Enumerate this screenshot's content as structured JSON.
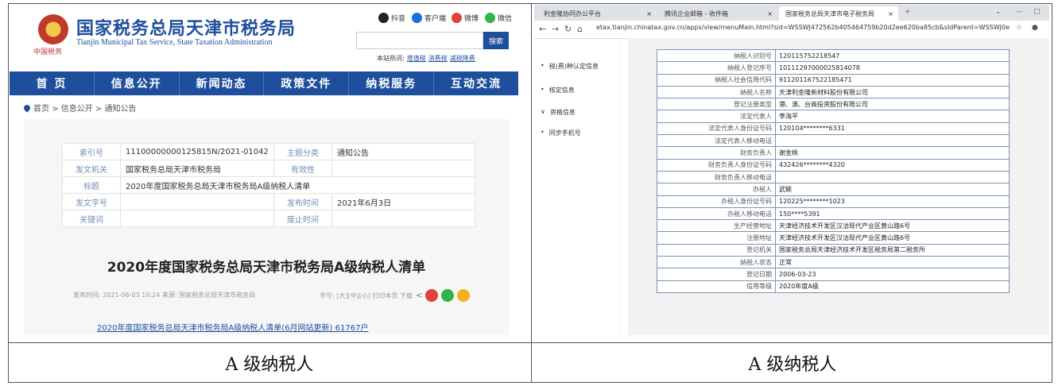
{
  "left": {
    "emblem_text": "中国税务",
    "site_title": "国家税务总局天津市税务局",
    "site_subtitle": "Tianjin Municipal Tax Service, State Taxation Administration",
    "social": [
      "抖音",
      "客户端",
      "微博",
      "微信"
    ],
    "search_button": "搜索",
    "hot_label": "本站热词:",
    "hot_words": [
      "增值税",
      "消费税",
      "减税降费"
    ],
    "nav": [
      "首 页",
      "信息公开",
      "新闻动态",
      "政策文件",
      "纳税服务",
      "互动交流"
    ],
    "breadcrumb": "首页 > 信息公开 > 通知公告",
    "info": {
      "index_label": "索引号",
      "index_value": "11100000000125815N/2021-01042",
      "topic_label": "主题分类",
      "topic_value": "通知公告",
      "org_label": "发文机关",
      "org_value": "国家税务总局天津市税务局",
      "validity_label": "有效性",
      "validity_value": "",
      "title_label": "标题",
      "title_value": "2020年度国家税务总局天津市税务局A级纳税人清单",
      "docno_label": "发文字号",
      "docno_value": "",
      "pubtime_label": "发布时间",
      "pubtime_value": "2021年6月3日",
      "keyword_label": "关键词",
      "keyword_value": "",
      "expire_label": "废止时间",
      "expire_value": ""
    },
    "doc_title": "2020年度国家税务总局天津市税务局A级纳税人清单",
    "meta": "发布时间: 2021-06-03 10:24  来源: 国家税务总局天津市税务局",
    "meta_right": "字号: [大][中][小] 打印本页 下载",
    "download_link": "2020年度国家税务总局天津市税务局A级纳税人清单(6月网站更新) 61767户"
  },
  "right": {
    "tabs": [
      "利金隆协同办公平台",
      "腾讯企业邮箱 - 收件箱",
      "国家税务总局天津市电子税务局"
    ],
    "url": "etax.tianjin.chinatax.gov.cn/apps/view/menuMain.html?sid=WSSWJ472562b405464759b20d2ee620ba85cb&sIdParent=WSSWJ0ea646a2366148b1a8b4ca...",
    "sidebar": [
      "税(费)种认定信息",
      "核定信息",
      "资格信息",
      "同步手机号"
    ],
    "rows": [
      [
        "纳税人识别号",
        "120115752218547"
      ],
      [
        "纳税人登记序号",
        "10111297000025814078"
      ],
      [
        "纳税人社会信用代码",
        "911201167522185471"
      ],
      [
        "纳税人名称",
        "天津利金隆新材料股份有限公司"
      ],
      [
        "登记注册类型",
        "港、澳、台商投资股份有限公司"
      ],
      [
        "法定代表人",
        "李海平"
      ],
      [
        "法定代表人身份证号码",
        "120104********6331"
      ],
      [
        "法定代表人移动电话",
        ""
      ],
      [
        "财务负责人",
        "谢金桃"
      ],
      [
        "财务负责人身份证号码",
        "432426********4320"
      ],
      [
        "财务负责人移动电话",
        ""
      ],
      [
        "办税人",
        "武颖"
      ],
      [
        "办税人身份证号码",
        "120225********1023"
      ],
      [
        "办税人移动电话",
        "150****5391"
      ],
      [
        "生产经营地址",
        "天津经济技术开发区汉沽现代产业区黄山路6号"
      ],
      [
        "注册地址",
        "天津经济技术开发区汉沽现代产业区黄山路6号"
      ],
      [
        "登记机关",
        "国家税务总局天津经济技术开发区税务局第二税务所"
      ],
      [
        "纳税人状态",
        "正常"
      ],
      [
        "登记日期",
        "2006-03-23"
      ],
      [
        "信用等级",
        "2020年度A级"
      ]
    ]
  },
  "captions": [
    "A 级纳税人",
    "A 级纳税人"
  ]
}
